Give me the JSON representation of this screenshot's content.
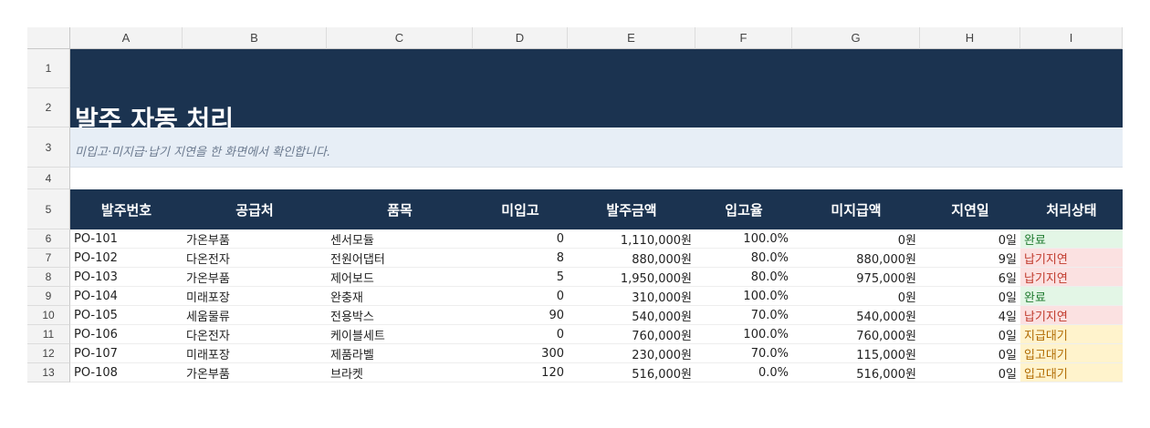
{
  "columns": [
    "A",
    "B",
    "C",
    "D",
    "E",
    "F",
    "G",
    "H",
    "I"
  ],
  "rows": [
    "1",
    "2",
    "3",
    "4",
    "5",
    "6",
    "7",
    "8",
    "9",
    "10",
    "11",
    "12",
    "13"
  ],
  "title": "발주 자동 처리",
  "subtitle": "미입고·미지급·납기 지연을 한 화면에서 확인합니다.",
  "headers": [
    "발주번호",
    "공급처",
    "품목",
    "미입고",
    "발주금액",
    "입고율",
    "미지급액",
    "지연일",
    "처리상태"
  ],
  "data": [
    [
      "PO-101",
      "가온부품",
      "센서모듈",
      "0",
      "1,110,000원",
      "100.0%",
      "0원",
      "0일",
      "완료"
    ],
    [
      "PO-102",
      "다온전자",
      "전원어댑터",
      "8",
      "880,000원",
      "80.0%",
      "880,000원",
      "9일",
      "납기지연"
    ],
    [
      "PO-103",
      "가온부품",
      "제어보드",
      "5",
      "1,950,000원",
      "80.0%",
      "975,000원",
      "6일",
      "납기지연"
    ],
    [
      "PO-104",
      "미래포장",
      "완충재",
      "0",
      "310,000원",
      "100.0%",
      "0원",
      "0일",
      "완료"
    ],
    [
      "PO-105",
      "세움물류",
      "전용박스",
      "90",
      "540,000원",
      "70.0%",
      "540,000원",
      "4일",
      "납기지연"
    ],
    [
      "PO-106",
      "다온전자",
      "케이블세트",
      "0",
      "760,000원",
      "100.0%",
      "760,000원",
      "0일",
      "지급대기"
    ],
    [
      "PO-107",
      "미래포장",
      "제품라벨",
      "300",
      "230,000원",
      "70.0%",
      "115,000원",
      "0일",
      "입고대기"
    ],
    [
      "PO-108",
      "가온부품",
      "브라켓",
      "120",
      "516,000원",
      "0.0%",
      "516,000원",
      "0일",
      "입고대기"
    ]
  ],
  "status_colors": {
    "완료": "#1e7a2e",
    "납기지연": "#c0392b",
    "지급대기": "#b06a00",
    "입고대기": "#b06a00"
  }
}
